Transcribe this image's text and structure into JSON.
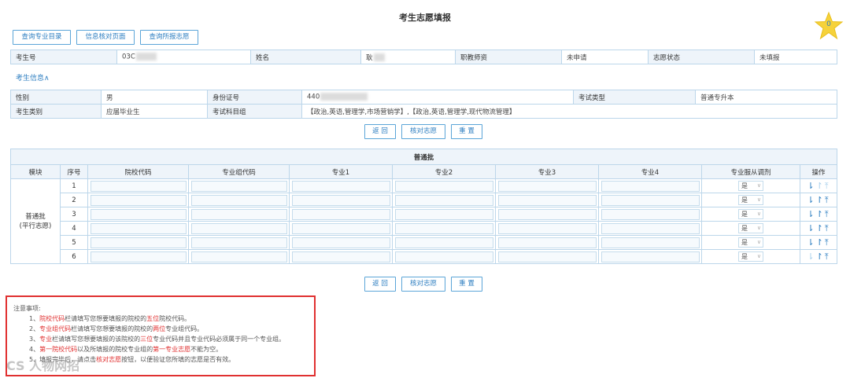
{
  "page": {
    "title": "考生志愿填报",
    "star_count": "0"
  },
  "toolbar": {
    "btn_majors": "查询专业目录",
    "btn_verify": "信息核对页面",
    "btn_report": "查询所报志愿"
  },
  "header_row": {
    "exam_no_label": "考生号",
    "exam_no_value": "03C",
    "name_label": "姓名",
    "name_value": "耿",
    "pro_cert_label": "职教师资",
    "pro_cert_value": "未申请",
    "status_label": "志愿状态",
    "status_value": "未填报"
  },
  "info_toggle": "考生信息∧",
  "info": {
    "gender_label": "性别",
    "gender_value": "男",
    "id_label": "身份证号",
    "id_value": "440",
    "exam_type_label": "考试类型",
    "exam_type_value": "普通专升本",
    "category_label": "考生类别",
    "category_value": "应届毕业生",
    "subjects_label": "考试科目组",
    "subjects_value": "【政治,英语,管理学,市场营销学】,【政治,英语,管理学,现代物流管理】"
  },
  "actions": {
    "back": "返 回",
    "check": "核对志愿",
    "reset": "重 置"
  },
  "main_table": {
    "section_title": "普通批",
    "headers": [
      "模块",
      "序号",
      "院校代码",
      "专业组代码",
      "专业1",
      "专业2",
      "专业3",
      "专业4",
      "专业服从调剂",
      "操作"
    ],
    "module_line1": "普通批",
    "module_line2": "(平行志愿)",
    "rows": [
      {
        "seq": "1",
        "adjust": "是"
      },
      {
        "seq": "2",
        "adjust": "是"
      },
      {
        "seq": "3",
        "adjust": "是"
      },
      {
        "seq": "4",
        "adjust": "是"
      },
      {
        "seq": "5",
        "adjust": "是"
      },
      {
        "seq": "6",
        "adjust": "是"
      }
    ]
  },
  "notes": {
    "heading": "注意事项:",
    "n1_pre": "1、",
    "n1_red1": "院校代码",
    "n1_mid": "栏请填写您想要填报的院校的",
    "n1_red2": "五位",
    "n1_post": "院校代码。",
    "n2_pre": "2、",
    "n2_red1": "专业组代码",
    "n2_mid": "栏请填写您想要填报的院校的",
    "n2_red2": "两位",
    "n2_post": "专业组代码。",
    "n3_pre": "3、",
    "n3_red1": "专业",
    "n3_mid": "栏请填写您想要填报的该院校的",
    "n3_red2": "三位",
    "n3_post": "专业代码并且专业代码必须属于同一个专业组。",
    "n4_pre": "4、",
    "n4_red1": "第一院校代码",
    "n4_mid": "以及所填报的院校专业组的",
    "n4_red2": "第一专业志愿",
    "n4_post": "不能为空。",
    "n5_pre": "5、",
    "n5_mid": "填报完毕后，请点击",
    "n5_red1": "核对志愿",
    "n5_post": "按钮，以便验证您所填的志愿是否有效。"
  },
  "watermark": "CS 人物网招"
}
